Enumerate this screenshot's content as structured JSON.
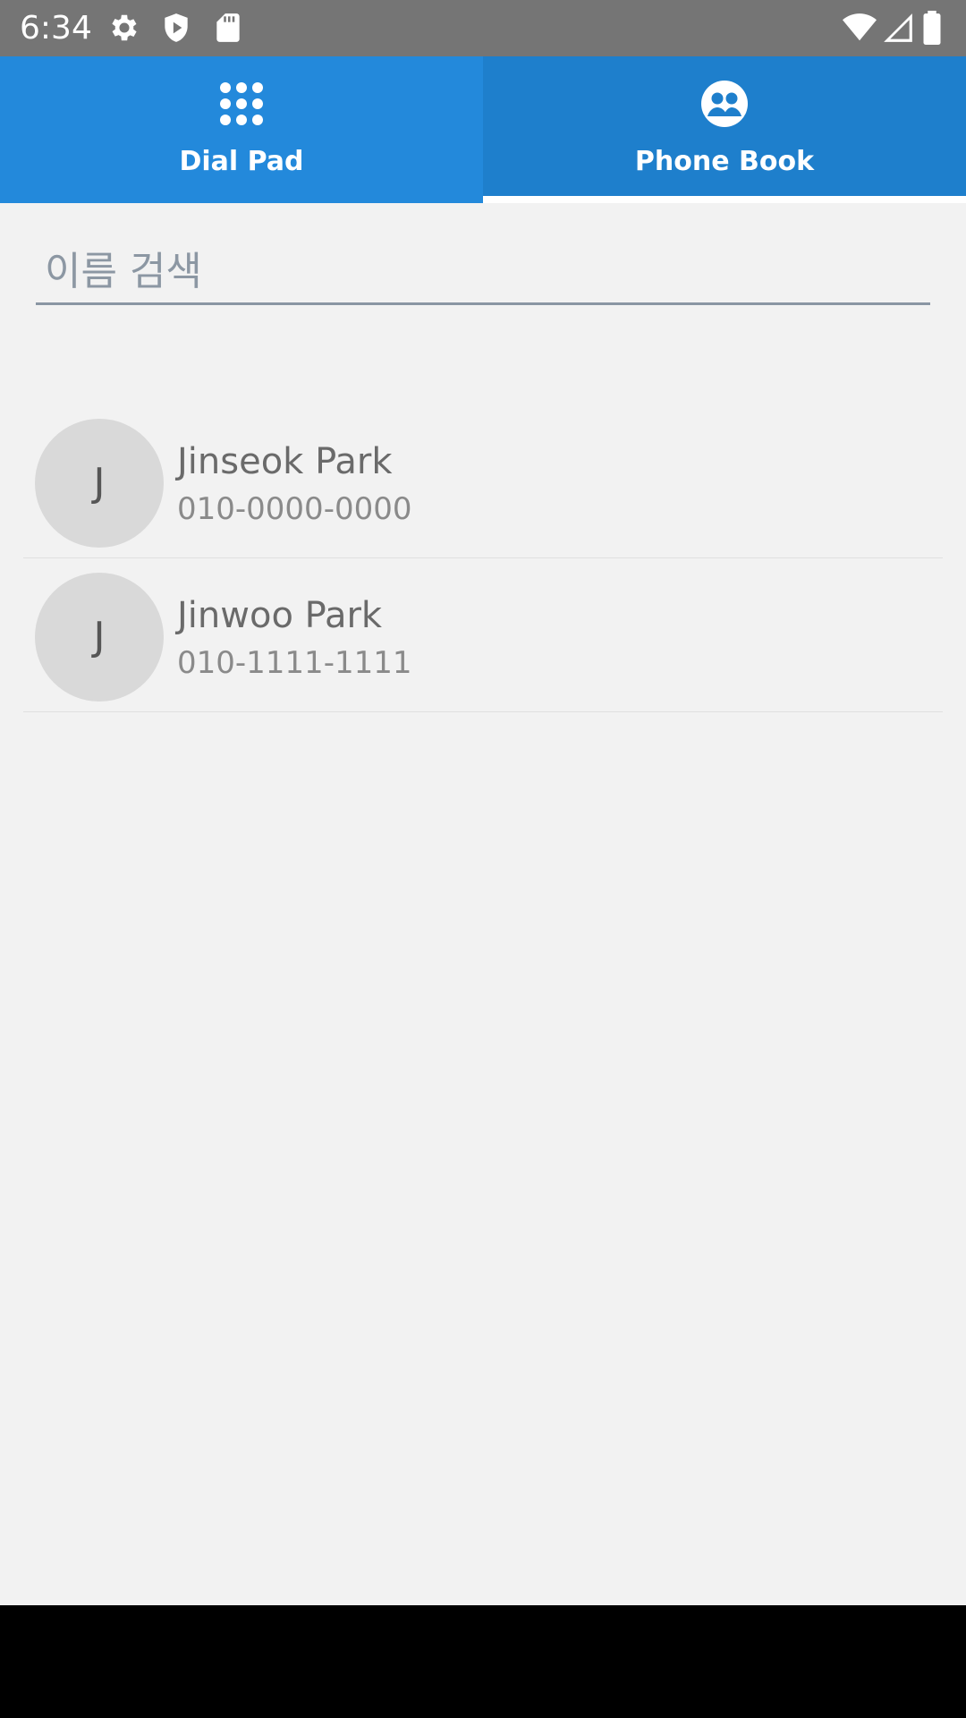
{
  "status_bar": {
    "time": "6:34",
    "icons_left": [
      "gear-icon",
      "shield-icon",
      "sd-card-icon"
    ],
    "icons_right": [
      "wifi-icon",
      "signal-icon",
      "battery-icon"
    ]
  },
  "tabs": [
    {
      "label": "Dial Pad",
      "icon": "dialpad-icon",
      "selected": false
    },
    {
      "label": "Phone Book",
      "icon": "contacts-icon",
      "selected": true
    }
  ],
  "search": {
    "placeholder": "이름 검색",
    "value": ""
  },
  "contacts": [
    {
      "initial": "J",
      "name": "Jinseok Park",
      "phone": "010-0000-0000"
    },
    {
      "initial": "J",
      "name": "Jinwoo Park",
      "phone": "010-1111-1111"
    }
  ],
  "colors": {
    "tab_dialpad": "#2389DB",
    "tab_phonebook": "#1E7FCC",
    "status_bar": "#757575",
    "content_bg": "#F2F2F2",
    "avatar_bg": "#D9D9D9"
  }
}
